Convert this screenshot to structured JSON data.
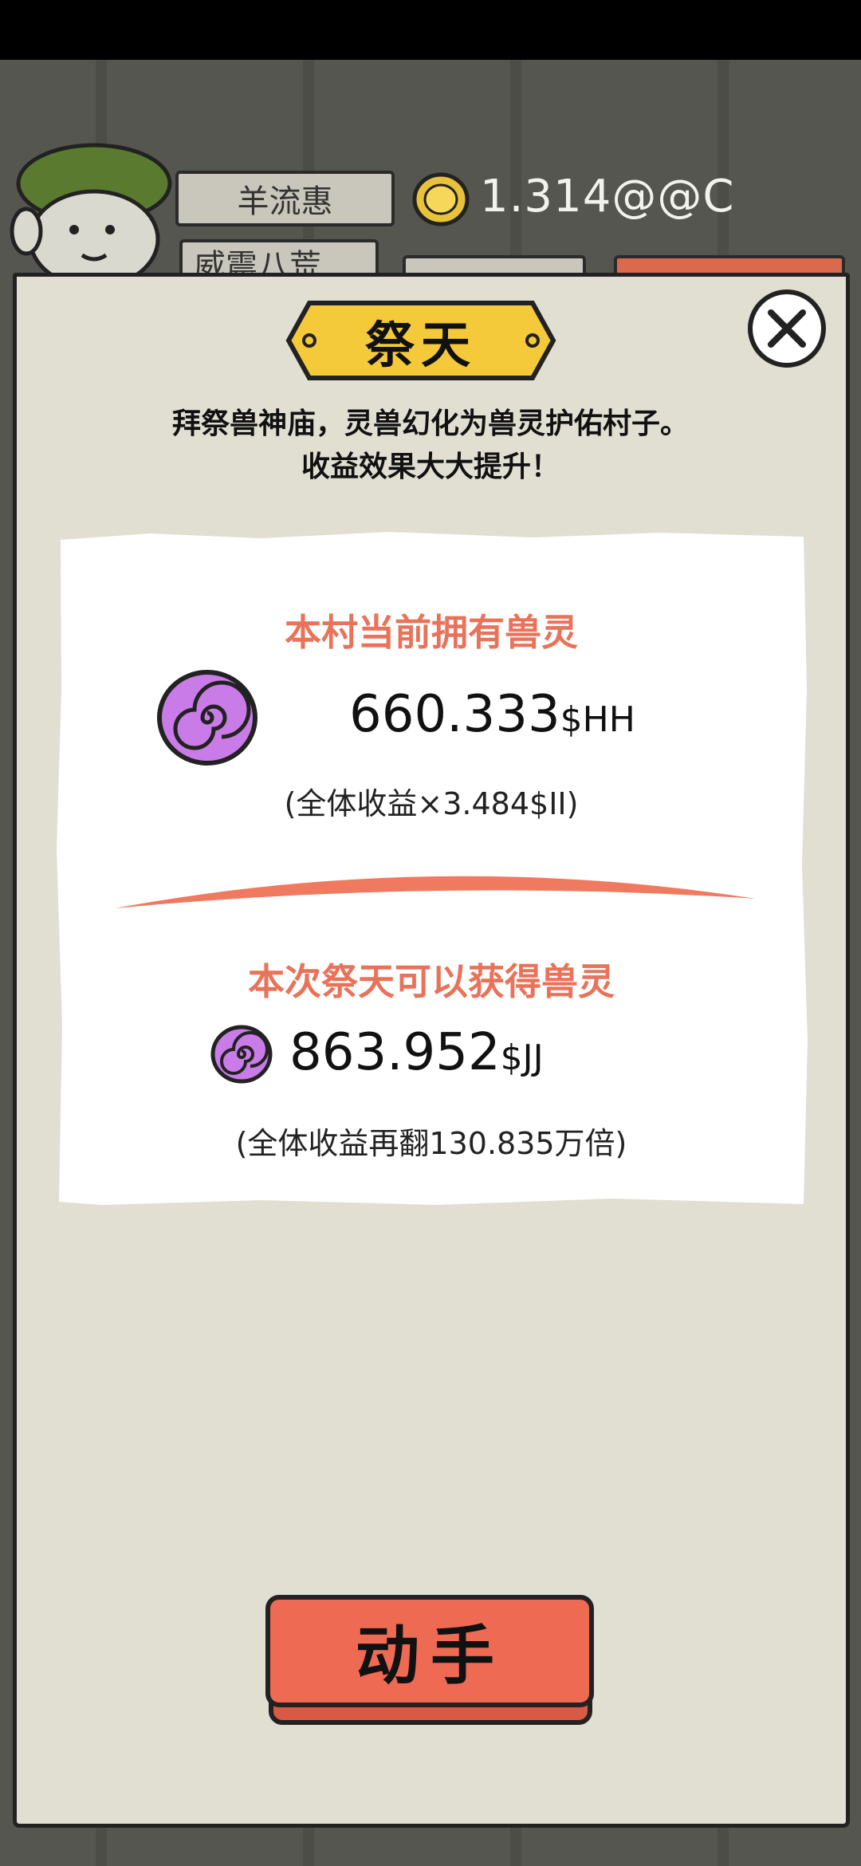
{
  "hud": {
    "player_name": "羊流惠",
    "village_name": "威震八荒",
    "coin_value": "1.314@@C"
  },
  "dialog": {
    "title": "祭天",
    "description_line1": "拜祭兽神庙，灵兽幻化为兽灵护佑村子。",
    "description_line2": "收益效果大大提升！",
    "current": {
      "heading": "本村当前拥有兽灵",
      "value": "660.333",
      "unit": "$HH",
      "note": "(全体收益×3.484$II)"
    },
    "gain": {
      "heading": "本次祭天可以获得兽灵",
      "value": "863.952",
      "unit": "$JJ",
      "note": "(全体收益再翻130.835万倍)"
    },
    "action_label": "动手"
  },
  "colors": {
    "accent": "#e8735a",
    "button": "#ee6a52",
    "badge": "#f4c93a",
    "swirl": "#c97ce8",
    "panel": "#e1dfd2"
  },
  "icons": [
    "avatar-icon",
    "coin-icon",
    "close-icon",
    "spirit-swirl-icon"
  ]
}
